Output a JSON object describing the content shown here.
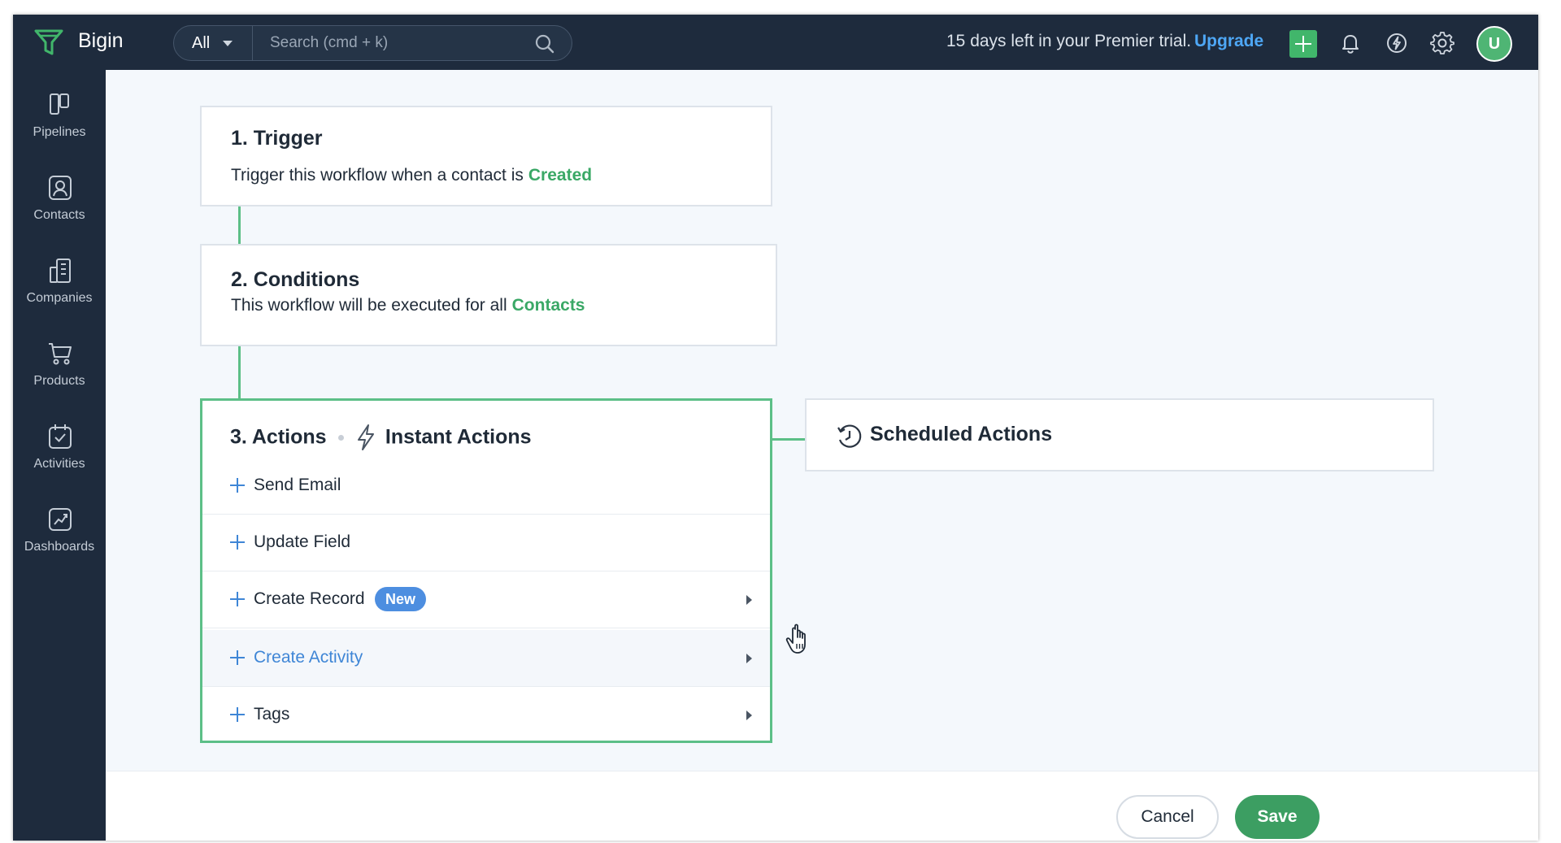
{
  "app": {
    "brand": "Bigin"
  },
  "header": {
    "search_scope": "All",
    "search_placeholder": "Search (cmd + k)",
    "trial_text": "15 days left in your Premier trial.",
    "upgrade_label": "Upgrade",
    "avatar_initial": "U",
    "icons": [
      "plus-icon",
      "bell-icon",
      "activity-bolt-icon",
      "gear-icon"
    ]
  },
  "sidebar": {
    "items": [
      {
        "label": "Pipelines",
        "icon": "pipelines-icon"
      },
      {
        "label": "Contacts",
        "icon": "contacts-icon"
      },
      {
        "label": "Companies",
        "icon": "companies-icon"
      },
      {
        "label": "Products",
        "icon": "cart-icon"
      },
      {
        "label": "Activities",
        "icon": "calendar-check-icon"
      },
      {
        "label": "Dashboards",
        "icon": "dashboard-chart-icon"
      }
    ]
  },
  "workflow": {
    "trigger": {
      "title": "1. Trigger",
      "text": "Trigger this workflow when a contact is",
      "value": "Created"
    },
    "conditions": {
      "title": "2. Conditions",
      "text": "This workflow will be executed for all",
      "value": "Contacts"
    },
    "actions": {
      "title": "3. Actions",
      "instant_label": "Instant Actions",
      "items": [
        {
          "label": "Send Email",
          "has_submenu": false
        },
        {
          "label": "Update Field",
          "has_submenu": false
        },
        {
          "label": "Create Record",
          "badge": "New",
          "has_submenu": true
        },
        {
          "label": "Create Activity",
          "has_submenu": true,
          "hovered": true
        },
        {
          "label": "Tags",
          "has_submenu": true
        }
      ]
    },
    "scheduled": {
      "title": "Scheduled Actions"
    }
  },
  "footer": {
    "cancel_label": "Cancel",
    "save_label": "Save"
  },
  "colors": {
    "topbar": "#1e2b3d",
    "accent_green": "#3aa866",
    "link_blue": "#3f86d6",
    "upgrade_blue": "#4ea7f5",
    "badge_blue": "#4d8ee0",
    "save_green": "#3c9e62"
  }
}
